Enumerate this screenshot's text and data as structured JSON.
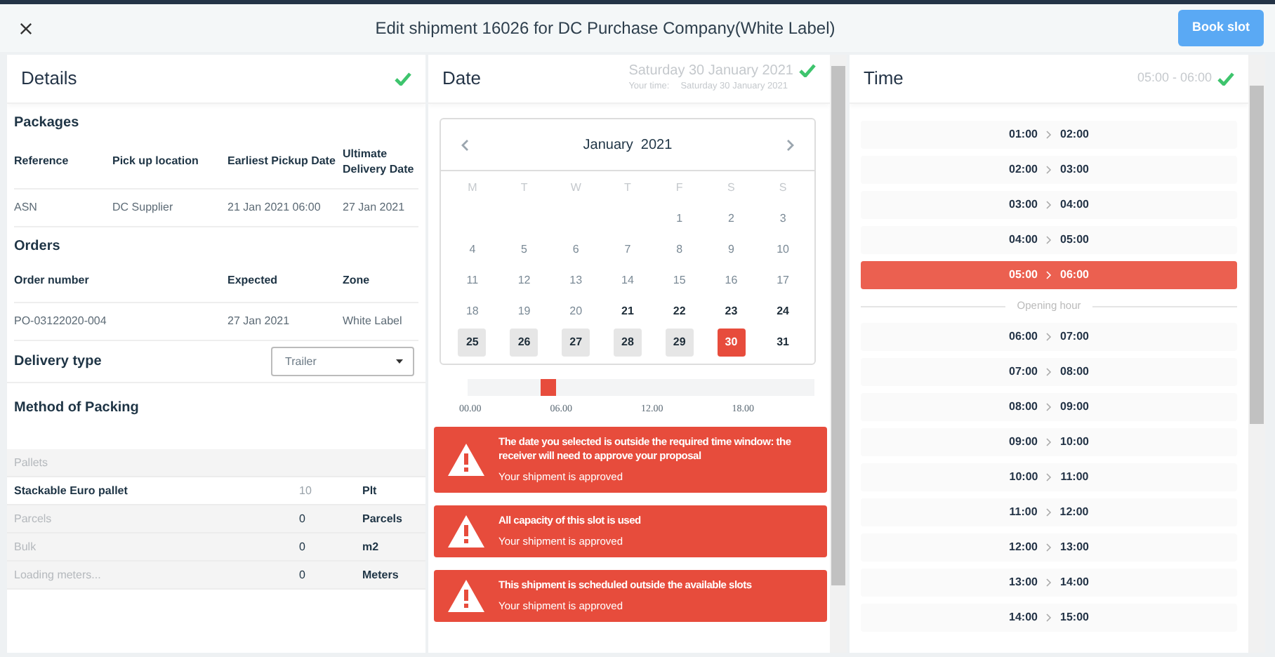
{
  "header": {
    "title": "Edit shipment 16026 for DC Purchase Company(White Label)",
    "button": "Book slot"
  },
  "details": {
    "title": "Details",
    "complete": true,
    "packages": {
      "title": "Packages",
      "columns": [
        "Reference",
        "Pick up location",
        "Earliest Pickup Date",
        "Ultimate Delivery Date"
      ],
      "rows": [
        [
          "ASN",
          "DC Supplier",
          "21 Jan 2021 06:00",
          "27 Jan 2021"
        ]
      ]
    },
    "orders": {
      "title": "Orders",
      "columns": [
        "Order number",
        "Expected",
        "Zone"
      ],
      "rows": [
        [
          "PO-03122020-004",
          "27 Jan 2021",
          "White Label"
        ]
      ]
    },
    "delivery_type": {
      "label": "Delivery type",
      "value": "Trailer"
    },
    "packing": {
      "title": "Method of Packing",
      "rows": [
        {
          "kind": "group",
          "label": "Pallets"
        },
        {
          "kind": "line",
          "active": true,
          "label": "Stackable Euro pallet",
          "quantity": "10",
          "unit": "Plt"
        },
        {
          "kind": "line",
          "active": false,
          "label": "Parcels",
          "quantity": "0",
          "unit": "Parcels"
        },
        {
          "kind": "line",
          "active": false,
          "label": "Bulk",
          "quantity": "0",
          "unit": "m2"
        },
        {
          "kind": "line",
          "active": false,
          "label": "Loading meters...",
          "quantity": "0",
          "unit": "Meters"
        }
      ]
    }
  },
  "date": {
    "title": "Date",
    "complete": true,
    "selected_date": "Saturday 30 January 2021",
    "your_time_label": "Your time:",
    "your_time": "Saturday 30 January 2021",
    "calendar": {
      "month": "January",
      "year": "2021",
      "weekdays": [
        "M",
        "T",
        "W",
        "T",
        "F",
        "S",
        "S"
      ],
      "weeks": [
        {
          "kind": "lead",
          "days": [
            {
              "day": "1",
              "available": false,
              "busy": false,
              "selected": false
            },
            {
              "day": "2",
              "available": false,
              "busy": false,
              "selected": false
            },
            {
              "day": "3",
              "available": false,
              "busy": false,
              "selected": false
            }
          ]
        },
        {
          "kind": "full",
          "days": [
            {
              "day": "4",
              "available": false,
              "busy": false,
              "selected": false
            },
            {
              "day": "5",
              "available": false,
              "busy": false,
              "selected": false
            },
            {
              "day": "6",
              "available": false,
              "busy": false,
              "selected": false
            },
            {
              "day": "7",
              "available": false,
              "busy": false,
              "selected": false
            },
            {
              "day": "8",
              "available": false,
              "busy": false,
              "selected": false
            },
            {
              "day": "9",
              "available": false,
              "busy": false,
              "selected": false
            },
            {
              "day": "10",
              "available": false,
              "busy": false,
              "selected": false
            }
          ]
        },
        {
          "kind": "full",
          "days": [
            {
              "day": "11",
              "available": false,
              "busy": false,
              "selected": false
            },
            {
              "day": "12",
              "available": false,
              "busy": false,
              "selected": false
            },
            {
              "day": "13",
              "available": false,
              "busy": false,
              "selected": false
            },
            {
              "day": "14",
              "available": false,
              "busy": false,
              "selected": false
            },
            {
              "day": "15",
              "available": false,
              "busy": false,
              "selected": false
            },
            {
              "day": "16",
              "available": false,
              "busy": false,
              "selected": false
            },
            {
              "day": "17",
              "available": false,
              "busy": false,
              "selected": false
            }
          ]
        },
        {
          "kind": "full",
          "days": [
            {
              "day": "18",
              "available": false,
              "busy": false,
              "selected": false
            },
            {
              "day": "19",
              "available": false,
              "busy": false,
              "selected": false
            },
            {
              "day": "20",
              "available": false,
              "busy": false,
              "selected": false
            },
            {
              "day": "21",
              "available": true,
              "busy": false,
              "selected": false
            },
            {
              "day": "22",
              "available": true,
              "busy": false,
              "selected": false
            },
            {
              "day": "23",
              "available": true,
              "busy": false,
              "selected": false
            },
            {
              "day": "24",
              "available": true,
              "busy": false,
              "selected": false
            }
          ]
        },
        {
          "kind": "full",
          "days": [
            {
              "day": "25",
              "available": true,
              "busy": true,
              "selected": false
            },
            {
              "day": "26",
              "available": true,
              "busy": true,
              "selected": false
            },
            {
              "day": "27",
              "available": true,
              "busy": true,
              "selected": false
            },
            {
              "day": "28",
              "available": true,
              "busy": true,
              "selected": false
            },
            {
              "day": "29",
              "available": true,
              "busy": true,
              "selected": false
            },
            {
              "day": "30",
              "available": true,
              "busy": false,
              "selected": true
            },
            {
              "day": "31",
              "available": true,
              "busy": false,
              "selected": false
            }
          ]
        }
      ]
    },
    "timeline": {
      "level": 0.21,
      "ticks": [
        "00.00",
        "06.00",
        "12.00",
        "18.00"
      ]
    },
    "alerts": [
      {
        "title": "The date you selected is outside the required time window: the receiver will need to approve your proposal",
        "text": "Your shipment is approved"
      },
      {
        "title": "All capacity of this slot is used",
        "text": "Your shipment is approved"
      },
      {
        "title": "This shipment is scheduled outside the available slots",
        "text": "Your shipment is approved"
      }
    ]
  },
  "time": {
    "title": "Time",
    "complete": true,
    "selected_range": "05:00 - 06:00",
    "slots": [
      {
        "kind": "slot",
        "from": "01:00",
        "to": "02:00",
        "selected": false
      },
      {
        "kind": "slot",
        "from": "02:00",
        "to": "03:00",
        "selected": false
      },
      {
        "kind": "slot",
        "from": "03:00",
        "to": "04:00",
        "selected": false
      },
      {
        "kind": "slot",
        "from": "04:00",
        "to": "05:00",
        "selected": false
      },
      {
        "kind": "slot",
        "from": "05:00",
        "to": "06:00",
        "selected": true
      },
      {
        "kind": "divider",
        "label": "Opening hour"
      },
      {
        "kind": "slot",
        "from": "06:00",
        "to": "07:00",
        "selected": false
      },
      {
        "kind": "slot",
        "from": "07:00",
        "to": "08:00",
        "selected": false
      },
      {
        "kind": "slot",
        "from": "08:00",
        "to": "09:00",
        "selected": false
      },
      {
        "kind": "slot",
        "from": "09:00",
        "to": "10:00",
        "selected": false
      },
      {
        "kind": "slot",
        "from": "10:00",
        "to": "11:00",
        "selected": false
      },
      {
        "kind": "slot",
        "from": "11:00",
        "to": "12:00",
        "selected": false
      },
      {
        "kind": "slot",
        "from": "12:00",
        "to": "13:00",
        "selected": false
      },
      {
        "kind": "slot",
        "from": "13:00",
        "to": "14:00",
        "selected": false
      },
      {
        "kind": "slot",
        "from": "14:00",
        "to": "15:00",
        "selected": false
      }
    ]
  }
}
